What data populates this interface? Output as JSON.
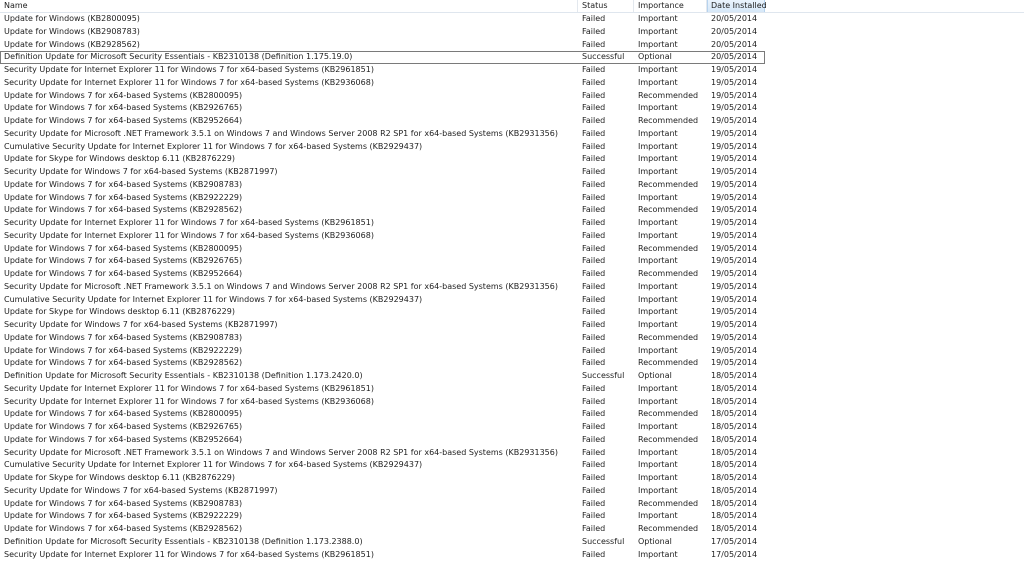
{
  "columns": {
    "name": "Name",
    "status": "Status",
    "importance": "Importance",
    "date_installed": "Date Installed"
  },
  "rows": [
    {
      "name": "Update for Windows (KB2800095)",
      "status": "Failed",
      "importance": "Important",
      "date": "20/05/2014"
    },
    {
      "name": "Update for Windows (KB2908783)",
      "status": "Failed",
      "importance": "Important",
      "date": "20/05/2014"
    },
    {
      "name": "Update for Windows (KB2928562)",
      "status": "Failed",
      "importance": "Important",
      "date": "20/05/2014"
    },
    {
      "name": "Definition Update for Microsoft Security Essentials - KB2310138 (Definition 1.175.19.0)",
      "status": "Successful",
      "importance": "Optional",
      "date": "20/05/2014"
    },
    {
      "name": "Security Update for Internet Explorer 11 for Windows 7 for x64-based Systems (KB2961851)",
      "status": "Failed",
      "importance": "Important",
      "date": "19/05/2014"
    },
    {
      "name": "Security Update for Internet Explorer 11 for Windows 7 for x64-based Systems (KB2936068)",
      "status": "Failed",
      "importance": "Important",
      "date": "19/05/2014"
    },
    {
      "name": "Update for Windows 7 for x64-based Systems (KB2800095)",
      "status": "Failed",
      "importance": "Recommended",
      "date": "19/05/2014"
    },
    {
      "name": "Update for Windows 7 for x64-based Systems (KB2926765)",
      "status": "Failed",
      "importance": "Important",
      "date": "19/05/2014"
    },
    {
      "name": "Update for Windows 7 for x64-based Systems (KB2952664)",
      "status": "Failed",
      "importance": "Recommended",
      "date": "19/05/2014"
    },
    {
      "name": "Security Update for Microsoft .NET Framework 3.5.1 on Windows 7 and Windows Server 2008 R2 SP1 for x64-based Systems (KB2931356)",
      "status": "Failed",
      "importance": "Important",
      "date": "19/05/2014"
    },
    {
      "name": "Cumulative Security Update for Internet Explorer 11 for Windows 7 for x64-based Systems (KB2929437)",
      "status": "Failed",
      "importance": "Important",
      "date": "19/05/2014"
    },
    {
      "name": "Update for Skype for Windows desktop 6.11 (KB2876229)",
      "status": "Failed",
      "importance": "Important",
      "date": "19/05/2014"
    },
    {
      "name": "Security Update for Windows 7 for x64-based Systems (KB2871997)",
      "status": "Failed",
      "importance": "Important",
      "date": "19/05/2014"
    },
    {
      "name": "Update for Windows 7 for x64-based Systems (KB2908783)",
      "status": "Failed",
      "importance": "Recommended",
      "date": "19/05/2014"
    },
    {
      "name": "Update for Windows 7 for x64-based Systems (KB2922229)",
      "status": "Failed",
      "importance": "Important",
      "date": "19/05/2014"
    },
    {
      "name": "Update for Windows 7 for x64-based Systems (KB2928562)",
      "status": "Failed",
      "importance": "Recommended",
      "date": "19/05/2014"
    },
    {
      "name": "Security Update for Internet Explorer 11 for Windows 7 for x64-based Systems (KB2961851)",
      "status": "Failed",
      "importance": "Important",
      "date": "19/05/2014"
    },
    {
      "name": "Security Update for Internet Explorer 11 for Windows 7 for x64-based Systems (KB2936068)",
      "status": "Failed",
      "importance": "Important",
      "date": "19/05/2014"
    },
    {
      "name": "Update for Windows 7 for x64-based Systems (KB2800095)",
      "status": "Failed",
      "importance": "Recommended",
      "date": "19/05/2014"
    },
    {
      "name": "Update for Windows 7 for x64-based Systems (KB2926765)",
      "status": "Failed",
      "importance": "Important",
      "date": "19/05/2014"
    },
    {
      "name": "Update for Windows 7 for x64-based Systems (KB2952664)",
      "status": "Failed",
      "importance": "Recommended",
      "date": "19/05/2014"
    },
    {
      "name": "Security Update for Microsoft .NET Framework 3.5.1 on Windows 7 and Windows Server 2008 R2 SP1 for x64-based Systems (KB2931356)",
      "status": "Failed",
      "importance": "Important",
      "date": "19/05/2014"
    },
    {
      "name": "Cumulative Security Update for Internet Explorer 11 for Windows 7 for x64-based Systems (KB2929437)",
      "status": "Failed",
      "importance": "Important",
      "date": "19/05/2014"
    },
    {
      "name": "Update for Skype for Windows desktop 6.11 (KB2876229)",
      "status": "Failed",
      "importance": "Important",
      "date": "19/05/2014"
    },
    {
      "name": "Security Update for Windows 7 for x64-based Systems (KB2871997)",
      "status": "Failed",
      "importance": "Important",
      "date": "19/05/2014"
    },
    {
      "name": "Update for Windows 7 for x64-based Systems (KB2908783)",
      "status": "Failed",
      "importance": "Recommended",
      "date": "19/05/2014"
    },
    {
      "name": "Update for Windows 7 for x64-based Systems (KB2922229)",
      "status": "Failed",
      "importance": "Important",
      "date": "19/05/2014"
    },
    {
      "name": "Update for Windows 7 for x64-based Systems (KB2928562)",
      "status": "Failed",
      "importance": "Recommended",
      "date": "19/05/2014"
    },
    {
      "name": "Definition Update for Microsoft Security Essentials - KB2310138 (Definition 1.173.2420.0)",
      "status": "Successful",
      "importance": "Optional",
      "date": "18/05/2014"
    },
    {
      "name": "Security Update for Internet Explorer 11 for Windows 7 for x64-based Systems (KB2961851)",
      "status": "Failed",
      "importance": "Important",
      "date": "18/05/2014"
    },
    {
      "name": "Security Update for Internet Explorer 11 for Windows 7 for x64-based Systems (KB2936068)",
      "status": "Failed",
      "importance": "Important",
      "date": "18/05/2014"
    },
    {
      "name": "Update for Windows 7 for x64-based Systems (KB2800095)",
      "status": "Failed",
      "importance": "Recommended",
      "date": "18/05/2014"
    },
    {
      "name": "Update for Windows 7 for x64-based Systems (KB2926765)",
      "status": "Failed",
      "importance": "Important",
      "date": "18/05/2014"
    },
    {
      "name": "Update for Windows 7 for x64-based Systems (KB2952664)",
      "status": "Failed",
      "importance": "Recommended",
      "date": "18/05/2014"
    },
    {
      "name": "Security Update for Microsoft .NET Framework 3.5.1 on Windows 7 and Windows Server 2008 R2 SP1 for x64-based Systems (KB2931356)",
      "status": "Failed",
      "importance": "Important",
      "date": "18/05/2014"
    },
    {
      "name": "Cumulative Security Update for Internet Explorer 11 for Windows 7 for x64-based Systems (KB2929437)",
      "status": "Failed",
      "importance": "Important",
      "date": "18/05/2014"
    },
    {
      "name": "Update for Skype for Windows desktop 6.11 (KB2876229)",
      "status": "Failed",
      "importance": "Important",
      "date": "18/05/2014"
    },
    {
      "name": "Security Update for Windows 7 for x64-based Systems (KB2871997)",
      "status": "Failed",
      "importance": "Important",
      "date": "18/05/2014"
    },
    {
      "name": "Update for Windows 7 for x64-based Systems (KB2908783)",
      "status": "Failed",
      "importance": "Recommended",
      "date": "18/05/2014"
    },
    {
      "name": "Update for Windows 7 for x64-based Systems (KB2922229)",
      "status": "Failed",
      "importance": "Important",
      "date": "18/05/2014"
    },
    {
      "name": "Update for Windows 7 for x64-based Systems (KB2928562)",
      "status": "Failed",
      "importance": "Recommended",
      "date": "18/05/2014"
    },
    {
      "name": "Definition Update for Microsoft Security Essentials - KB2310138 (Definition 1.173.2388.0)",
      "status": "Successful",
      "importance": "Optional",
      "date": "17/05/2014"
    },
    {
      "name": "Security Update for Internet Explorer 11 for Windows 7 for x64-based Systems (KB2961851)",
      "status": "Failed",
      "importance": "Important",
      "date": "17/05/2014"
    }
  ]
}
